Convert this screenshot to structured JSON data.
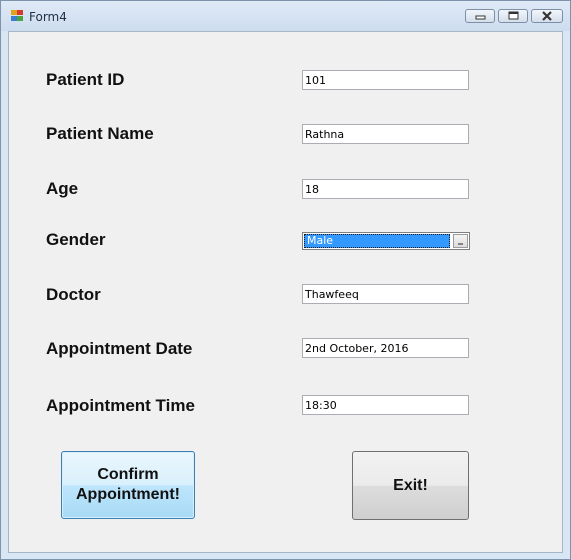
{
  "window": {
    "title": "Form4",
    "app_icon": "form-app-icon",
    "controls": {
      "minimize": "minimize-icon",
      "maximize": "maximize-icon",
      "close": "close-icon"
    }
  },
  "form": {
    "patient_id": {
      "label": "Patient ID",
      "value": "101"
    },
    "patient_name": {
      "label": "Patient Name",
      "value": "Rathna"
    },
    "age": {
      "label": "Age",
      "value": "18"
    },
    "gender": {
      "label": "Gender",
      "value": "Male"
    },
    "doctor": {
      "label": "Doctor",
      "value": "Thawfeeq"
    },
    "appointment_date": {
      "label": "Appointment Date",
      "value": "2nd October, 2016"
    },
    "appointment_time": {
      "label": "Appointment Time",
      "value": "18:30"
    }
  },
  "buttons": {
    "confirm_line1": "Confirm",
    "confirm_line2": "Appointment!",
    "exit": "Exit!"
  },
  "colors": {
    "selection_highlight": "#3399ff",
    "client_background": "#f0f0f0",
    "focused_button_border": "#3c7fb1"
  }
}
